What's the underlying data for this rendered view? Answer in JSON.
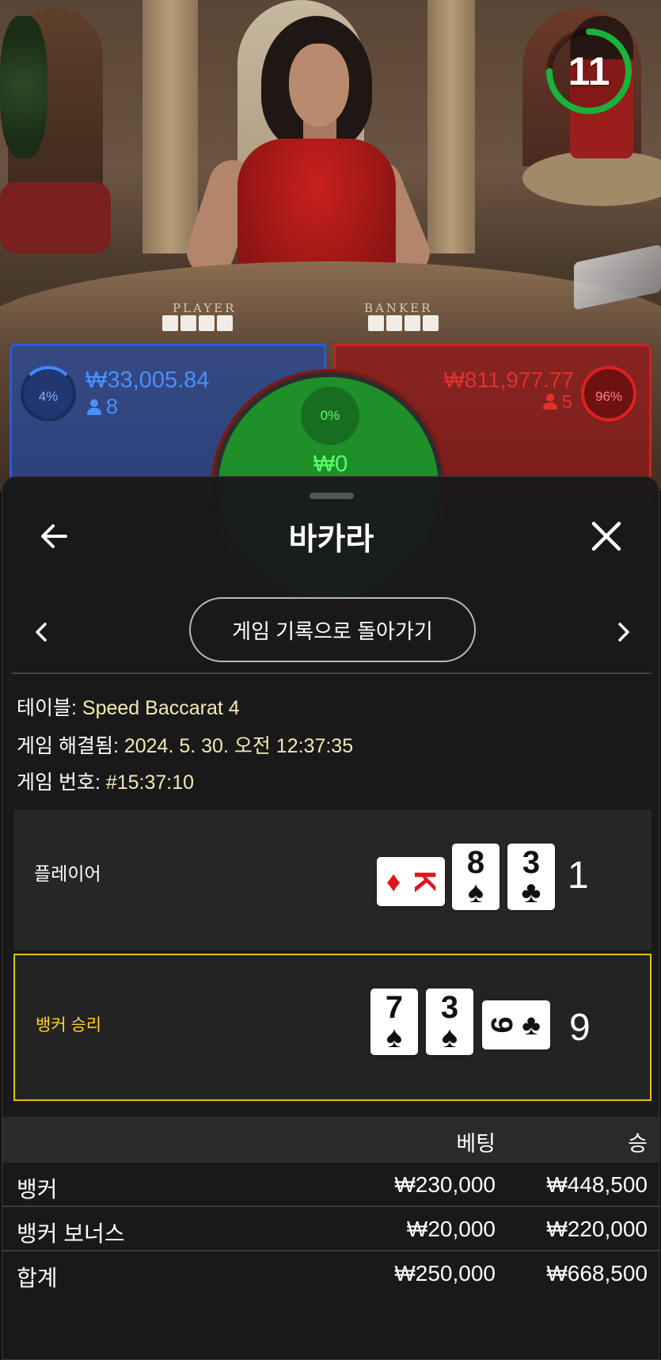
{
  "video": {
    "timer": "11",
    "felt_player_label": "PLAYER",
    "felt_banker_label": "BANKER"
  },
  "spots": {
    "player": {
      "percent": "4%",
      "amount": "₩33,005.84",
      "count": "8"
    },
    "banker": {
      "percent": "96%",
      "amount": "₩811,977.77",
      "count": "5"
    },
    "tie": {
      "percent": "0%",
      "amount": "₩0"
    }
  },
  "sheet": {
    "title": "바카라",
    "back_to_history": "게임 기록으로 돌아가기",
    "info": {
      "table_label": "테이블: ",
      "table_value": "Speed Baccarat 4",
      "resolved_label": "게임 해결됨: ",
      "resolved_value": "2024. 5. 30. 오전 12:37:35",
      "game_no_label": "게임 번호: ",
      "game_no_value": "#15:37:10"
    },
    "player_row": {
      "label": "플레이어",
      "score": "1",
      "cards": [
        {
          "rank": "K",
          "suit": "♦",
          "color": "#e1141c",
          "orientation": "sideways"
        },
        {
          "rank": "8",
          "suit": "♠",
          "color": "#111111",
          "orientation": "upright"
        },
        {
          "rank": "3",
          "suit": "♣",
          "color": "#111111",
          "orientation": "upright"
        }
      ]
    },
    "banker_row": {
      "label": "뱅커 승리",
      "score": "9",
      "highlight_color": "#e8c000",
      "cards": [
        {
          "rank": "7",
          "suit": "♠",
          "color": "#111111",
          "orientation": "upright"
        },
        {
          "rank": "3",
          "suit": "♠",
          "color": "#111111",
          "orientation": "upright"
        },
        {
          "rank": "9",
          "suit": "♣",
          "color": "#111111",
          "orientation": "sideways"
        }
      ]
    },
    "bets": {
      "header_bet": "베팅",
      "header_win": "승",
      "rows": [
        {
          "name": "뱅커",
          "bet": "₩230,000",
          "win": "₩448,500"
        },
        {
          "name": "뱅커 보너스",
          "bet": "₩20,000",
          "win": "₩220,000"
        },
        {
          "name": "합계",
          "bet": "₩250,000",
          "win": "₩668,500"
        }
      ]
    }
  },
  "colors": {
    "player_blue": "#2a5bd4",
    "banker_red": "#d02020",
    "tie_green": "#1f8f2a",
    "timer_green": "#19b33a",
    "value_yellow": "#f4e9b6"
  }
}
